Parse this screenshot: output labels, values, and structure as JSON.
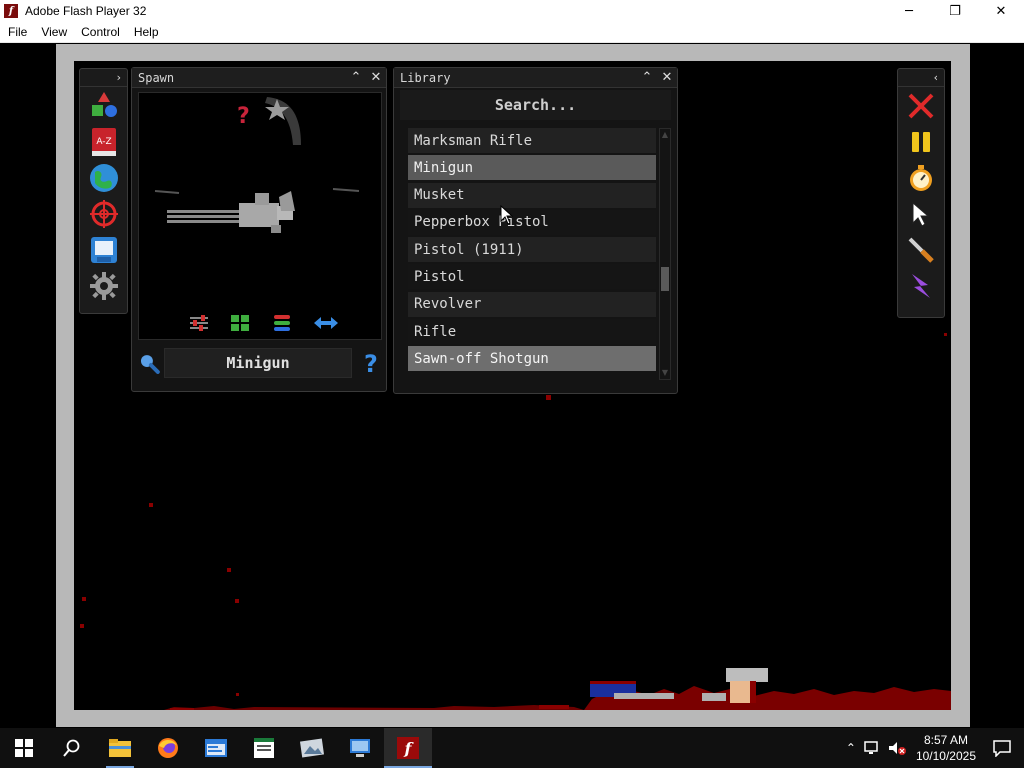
{
  "window": {
    "title": "Adobe Flash Player 32",
    "minimize_glyph": "─",
    "restore_glyph": "❐",
    "close_glyph": "✕"
  },
  "menu": [
    "File",
    "View",
    "Control",
    "Help"
  ],
  "tool_strip_left": {
    "tools": [
      "shapes-icon",
      "a-z-book-icon",
      "globe-icon",
      "target-icon",
      "save-icon",
      "gear-icon"
    ],
    "book_label": "A-Z"
  },
  "spawn_panel": {
    "title": "Spawn",
    "selected_item": "Minigun",
    "preview_badges": [
      "question-mark-icon",
      "star-icon"
    ],
    "bottom_tools": [
      "sliders-icon",
      "grid-icon",
      "layers-icon",
      "flip-arrows-icon"
    ]
  },
  "library_panel": {
    "title": "Library",
    "search_placeholder": "Search...",
    "items": [
      {
        "label": "Marksman Rifle",
        "state": "normal"
      },
      {
        "label": "Minigun",
        "state": "selected"
      },
      {
        "label": "Musket",
        "state": "normal"
      },
      {
        "label": "Pepperbox Pistol",
        "state": "normal"
      },
      {
        "label": "Pistol (1911)",
        "state": "normal"
      },
      {
        "label": "Pistol",
        "state": "normal"
      },
      {
        "label": "Revolver",
        "state": "normal"
      },
      {
        "label": "Rifle",
        "state": "normal"
      },
      {
        "label": "Sawn-off Shotgun",
        "state": "highlighted"
      }
    ]
  },
  "tool_strip_right": {
    "tools": [
      "close-x-icon",
      "pause-icon",
      "stopwatch-icon",
      "pointer-icon",
      "knife-icon",
      "lightning-icon"
    ]
  },
  "taskbar": {
    "apps": [
      "start-icon",
      "search-icon",
      "file-explorer-icon",
      "firefox-icon",
      "app-window-icon",
      "document-icon",
      "image-viewer-icon",
      "remote-desktop-icon",
      "flash-player-icon"
    ],
    "clock_time": "8:57 AM",
    "clock_date": "10/10/2025"
  },
  "colors": {
    "stage_bg": "#000000",
    "stage_frame": "#b8b8b8",
    "panel_bg": "#141414",
    "selected_row": "#5a5a5a",
    "blood": "#8a0000",
    "accent_blue": "#3a8ee6"
  }
}
